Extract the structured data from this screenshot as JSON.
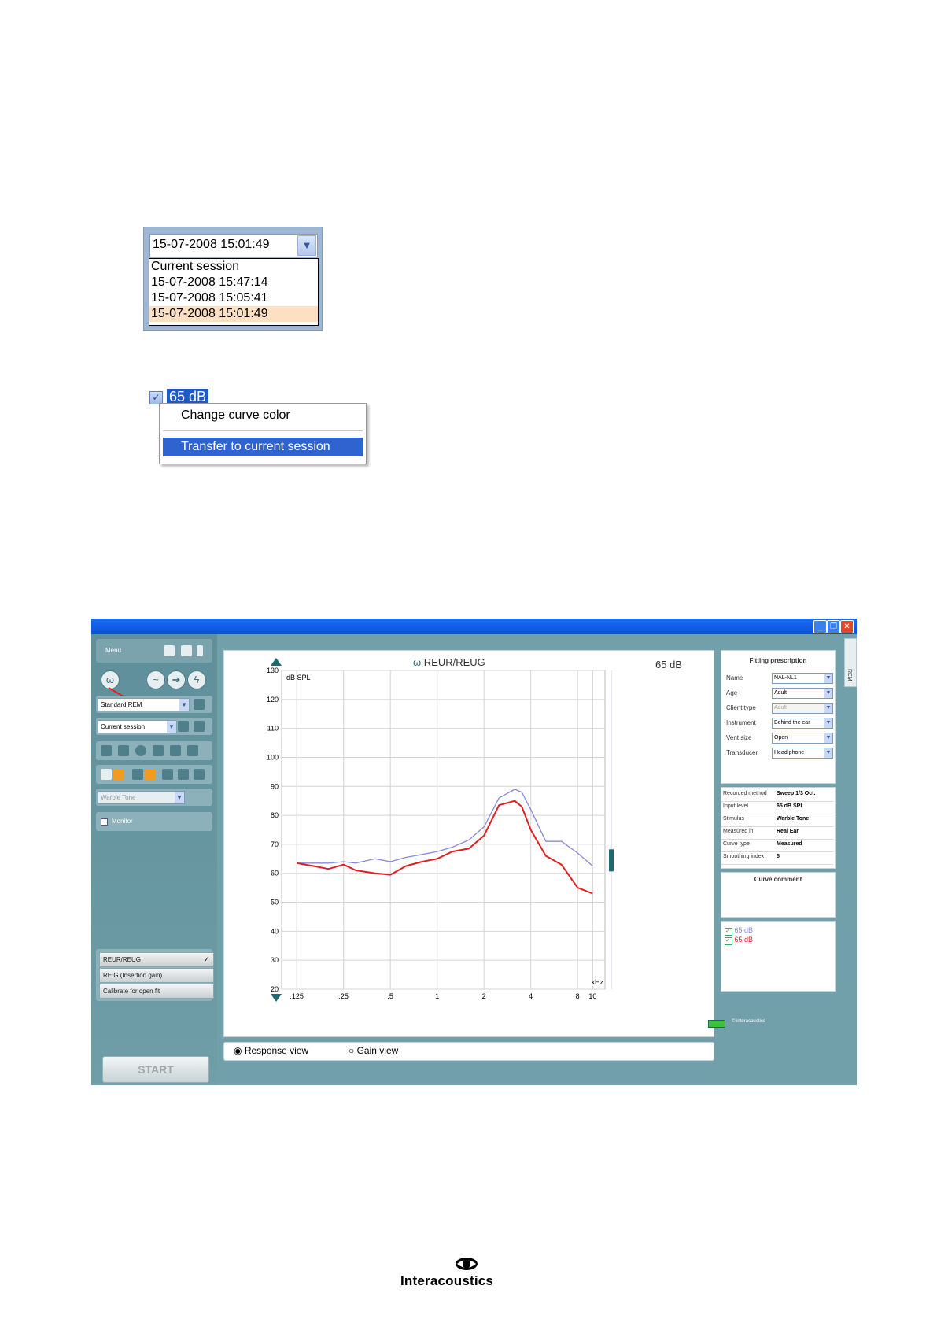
{
  "date_dropdown": {
    "selected": "15-07-2008 15:01:49",
    "options": [
      "Current session",
      "15-07-2008 15:47:14",
      "15-07-2008 15:05:41",
      "15-07-2008 15:01:49"
    ]
  },
  "context_menu": {
    "checkbox_label": "65 dB",
    "items": [
      "Change curve color",
      "Transfer to current session"
    ]
  },
  "app": {
    "menu_label": "Menu",
    "protocol_select": "Standard REM",
    "session_select": "Current session",
    "stimulus_select": "Warble Tone",
    "monitor_label": "Monitor",
    "test_buttons": [
      "REUR/REUG",
      "REIG (Insertion gain)",
      "Calibrate for open fit"
    ],
    "start_label": "START",
    "graph_title": "REUR/REUG",
    "level_readout": "65 dB",
    "views": {
      "response": "Response view",
      "gain": "Gain view"
    },
    "fitting": {
      "title": "Fitting prescription",
      "rows": [
        {
          "label": "Name",
          "value": "NAL-NL1"
        },
        {
          "label": "Age",
          "value": "Adult"
        },
        {
          "label": "Client type",
          "value": "Adult"
        },
        {
          "label": "Instrument",
          "value": "Behind the ear"
        },
        {
          "label": "Vent size",
          "value": "Open"
        },
        {
          "label": "Transducer",
          "value": "Head phone"
        }
      ]
    },
    "recorded": [
      {
        "key": "Recorded method",
        "value": "Sweep 1/3 Oct."
      },
      {
        "key": "Input level",
        "value": "65 dB SPL"
      },
      {
        "key": "Stimulus",
        "value": "Warble Tone"
      },
      {
        "key": "Measured in",
        "value": "Real Ear"
      },
      {
        "key": "Curve type",
        "value": "Measured"
      },
      {
        "key": "Smoothing index",
        "value": "5"
      }
    ],
    "curve_comment_title": "Curve comment",
    "legend": [
      {
        "label": "65 dB",
        "color": "#8a8ad8"
      },
      {
        "label": "65 dB",
        "color": "#e02020"
      }
    ],
    "tab_label": "REM",
    "brand_small": "© interacoustics",
    "accent": "#0b4fd9"
  },
  "chart_data": {
    "type": "line",
    "title": "REUR/REUG",
    "ylabel": "dB SPL",
    "xlabel": "kHz",
    "xscale": "log",
    "xlim": [
      0.1,
      12
    ],
    "ylim": [
      20,
      130
    ],
    "x_ticks": [
      ".125",
      ".25",
      ".5",
      "1",
      "2",
      "4",
      "8",
      "10"
    ],
    "y_ticks": [
      20,
      30,
      40,
      50,
      60,
      70,
      80,
      90,
      100,
      110,
      120,
      130
    ],
    "grid": true,
    "series": [
      {
        "name": "65 dB",
        "color": "#8a8ad8",
        "points": [
          [
            0.125,
            63.5
          ],
          [
            0.16,
            63.5
          ],
          [
            0.2,
            63.5
          ],
          [
            0.25,
            64
          ],
          [
            0.3,
            63.5
          ],
          [
            0.4,
            65
          ],
          [
            0.5,
            64
          ],
          [
            0.63,
            65.5
          ],
          [
            0.8,
            66.5
          ],
          [
            1,
            67.5
          ],
          [
            1.25,
            69
          ],
          [
            1.6,
            71.5
          ],
          [
            2,
            76
          ],
          [
            2.5,
            86
          ],
          [
            3.15,
            89
          ],
          [
            3.5,
            88
          ],
          [
            4,
            82
          ],
          [
            5,
            71
          ],
          [
            6.3,
            71
          ],
          [
            8,
            67
          ],
          [
            10,
            62.5
          ]
        ]
      },
      {
        "name": "65 dB",
        "color": "#e02020",
        "points": [
          [
            0.125,
            63.5
          ],
          [
            0.16,
            62.5
          ],
          [
            0.2,
            61.5
          ],
          [
            0.25,
            63
          ],
          [
            0.3,
            61
          ],
          [
            0.4,
            60
          ],
          [
            0.5,
            59.5
          ],
          [
            0.63,
            62.5
          ],
          [
            0.8,
            64
          ],
          [
            1,
            65
          ],
          [
            1.25,
            67.5
          ],
          [
            1.6,
            68.5
          ],
          [
            2,
            73
          ],
          [
            2.5,
            83.5
          ],
          [
            3.15,
            85
          ],
          [
            3.5,
            83
          ],
          [
            4,
            75
          ],
          [
            5,
            66
          ],
          [
            6.3,
            63
          ],
          [
            8,
            55
          ],
          [
            10,
            53
          ]
        ]
      }
    ]
  },
  "logo": {
    "text": "Interacoustics"
  }
}
